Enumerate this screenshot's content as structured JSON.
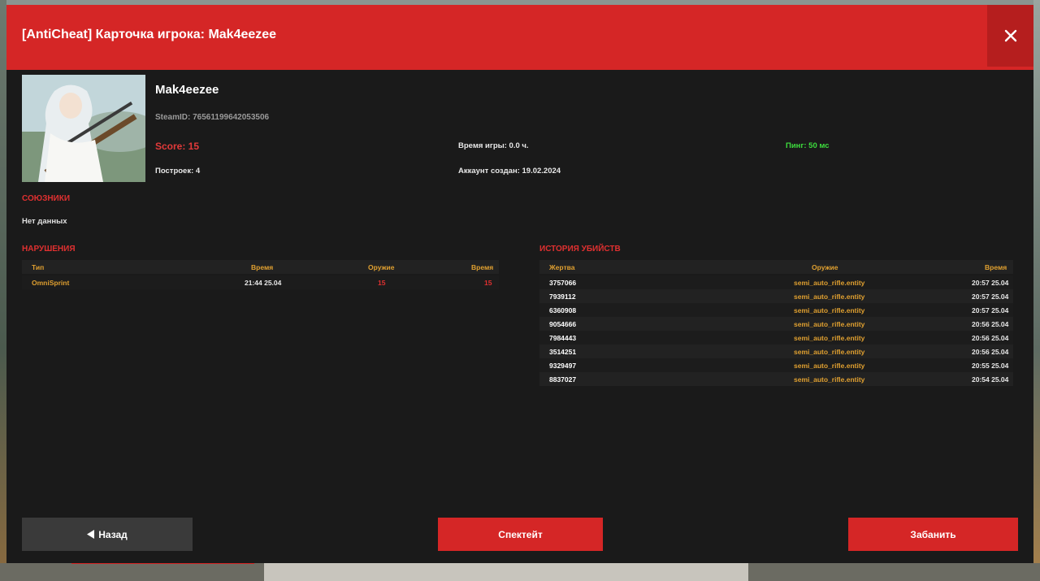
{
  "header": {
    "title": "[AntiCheat] Карточка игрока: Mak4eezee"
  },
  "player": {
    "name": "Mak4eezee",
    "steamid": "SteamID: 76561199642053506",
    "score": "Score: 15",
    "playtime": "Время игры: 0.0 ч.",
    "ping": "Пинг: 50 мс",
    "buildings": "Построек: 4",
    "account_created": "Аккаунт создан: 19.02.2024"
  },
  "allies": {
    "title": "СОЮЗНИКИ",
    "empty_text": "Нет данных"
  },
  "violations": {
    "title": "НАРУШЕНИЯ",
    "headers": [
      "Тип",
      "Время",
      "Оружие",
      "Время"
    ],
    "rows": [
      [
        "OmniSprint",
        "21:44 25.04",
        "15",
        "15"
      ]
    ]
  },
  "kills": {
    "title": "ИСТОРИЯ УБИЙСТВ",
    "headers": [
      "Жертва",
      "Оружие",
      "Время"
    ],
    "rows": [
      [
        "3757066",
        "semi_auto_rifle.entity",
        "20:57 25.04"
      ],
      [
        "7939112",
        "semi_auto_rifle.entity",
        "20:57 25.04"
      ],
      [
        "6360908",
        "semi_auto_rifle.entity",
        "20:57 25.04"
      ],
      [
        "9054666",
        "semi_auto_rifle.entity",
        "20:56 25.04"
      ],
      [
        "7984443",
        "semi_auto_rifle.entity",
        "20:56 25.04"
      ],
      [
        "3514251",
        "semi_auto_rifle.entity",
        "20:56 25.04"
      ],
      [
        "9329497",
        "semi_auto_rifle.entity",
        "20:55 25.04"
      ],
      [
        "8837027",
        "semi_auto_rifle.entity",
        "20:54 25.04"
      ]
    ]
  },
  "buttons": {
    "back": "Назад",
    "spectate": "Спектейт",
    "ban": "Забанить"
  },
  "colors": {
    "accent": "#d52626",
    "panel": "#1a1a1a",
    "header_text": "#e0a030",
    "ping": "#3ddc3d"
  }
}
